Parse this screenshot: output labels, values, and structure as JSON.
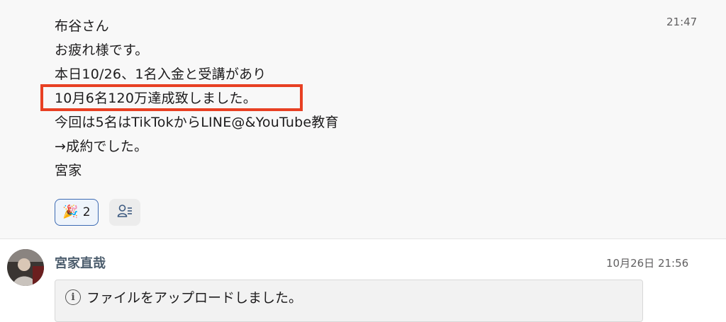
{
  "message1": {
    "lines": [
      "布谷さん",
      "お疲れ様です。",
      "本日10/26、1名入金と受講があり",
      "10月6名120万達成致しました。",
      "今回は5名はTikTokからLINE@&YouTube教育",
      "→成約でした。",
      "宮家"
    ],
    "time": "21:47",
    "reaction": {
      "emoji": "🎉",
      "count": "2"
    },
    "highlight_color": "#e84023"
  },
  "message2": {
    "sender": "宮家直哉",
    "time": "10月26日 21:56",
    "file_notice": "ファイルをアップロードしました。"
  },
  "icons": [
    "party-popper-icon",
    "add-reaction-icon",
    "info-icon"
  ]
}
